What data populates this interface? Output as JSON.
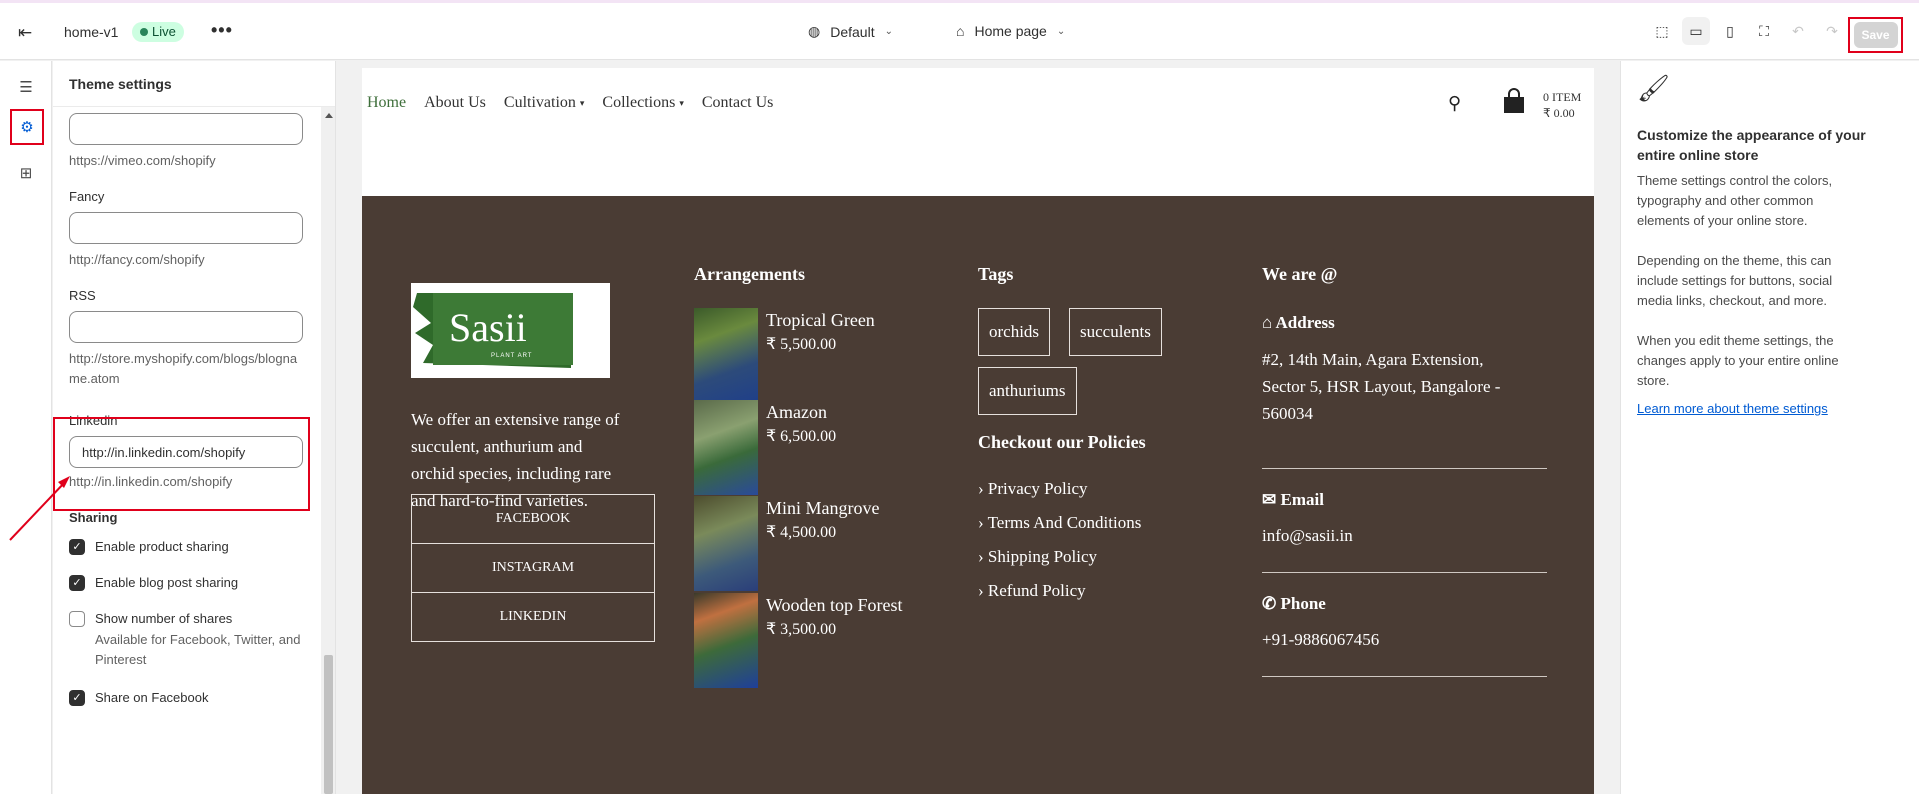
{
  "topbar": {
    "theme_name": "home-v1",
    "status_badge": "Live",
    "more": "•••",
    "preset": "Default",
    "page": "Home page",
    "save_label": "Save"
  },
  "icons": {
    "exit": "exit-icon",
    "globe": "globe-icon",
    "home": "home-icon",
    "inspector": "inspector-icon",
    "desktop": "desktop-icon",
    "mobile": "mobile-icon",
    "fullscreen": "fullscreen-icon",
    "undo": "undo-icon",
    "redo": "redo-icon",
    "sections": "sections-icon",
    "theme_settings": "gear-icon",
    "apps": "apps-icon",
    "paintbrush": "paintbrush-icon"
  },
  "settings": {
    "title": "Theme settings",
    "fields": [
      {
        "label": "",
        "value": "",
        "help": "https://vimeo.com/shopify"
      },
      {
        "label": "Fancy",
        "value": "",
        "help": "http://fancy.com/shopify"
      },
      {
        "label": "RSS",
        "value": "",
        "help": "http://store.myshopify.com/blogs/blogname.atom"
      },
      {
        "label": "Linkedin",
        "value": "http://in.linkedin.com/shopify",
        "help": "http://in.linkedin.com/shopify"
      }
    ],
    "sharing_title": "Sharing",
    "checkboxes": [
      {
        "label": "Enable product sharing",
        "checked": true,
        "sub": ""
      },
      {
        "label": "Enable blog post sharing",
        "checked": true,
        "sub": ""
      },
      {
        "label": "Show number of shares",
        "checked": false,
        "sub": "Available for Facebook, Twitter, and Pinterest"
      },
      {
        "label": "Share on Facebook",
        "checked": true,
        "sub": ""
      }
    ]
  },
  "store": {
    "nav": [
      "Home",
      "About Us",
      "Cultivation",
      "Collections",
      "Contact Us"
    ],
    "cart_count": "0  ITEM",
    "cart_total": "₹ 0.00",
    "logo_text": "Sasii",
    "logo_sub": "PLANT ART",
    "about": "We offer an extensive range of succulent, anthurium and orchid species, including rare and hard-to-find varieties.",
    "social": [
      "FACEBOOK",
      "INSTAGRAM",
      "LINKEDIN"
    ],
    "arrangements_title": "Arrangements",
    "products": [
      {
        "name": "Tropical Green",
        "price": "₹ 5,500.00"
      },
      {
        "name": "Amazon",
        "price": "₹ 6,500.00"
      },
      {
        "name": "Mini Mangrove",
        "price": "₹ 4,500.00"
      },
      {
        "name": "Wooden top Forest",
        "price": "₹ 3,500.00"
      }
    ],
    "tags_title": "Tags",
    "tags": [
      "orchids",
      "succulents",
      "anthuriums"
    ],
    "policies_title": "Checkout our Policies",
    "policies": [
      "Privacy Policy",
      "Terms And Conditions",
      "Shipping Policy",
      "Refund Policy"
    ],
    "contact_title": "We are @",
    "address_label": "Address",
    "address": "#2, 14th Main, Agara Extension, Sector 5, HSR Layout, Bangalore - 560034",
    "email_label": "Email",
    "email": "info@sasii.in",
    "phone_label": "Phone",
    "phone": "+91-9886067456"
  },
  "right_panel": {
    "heading": "Customize the appearance of your entire online store",
    "p1": "Theme settings control the colors, typography and other common elements of your online store.",
    "p2": "Depending on the theme, this can include settings for buttons, social media links, checkout, and more.",
    "p3": "When you edit theme settings, the changes apply to your entire online store.",
    "link": "Learn more about theme settings"
  },
  "colors": {
    "footer_bg": "#4a3c34",
    "accent_green": "#3e6e3a",
    "link_blue": "#005bd3",
    "annotation_red": "#e0001b"
  }
}
